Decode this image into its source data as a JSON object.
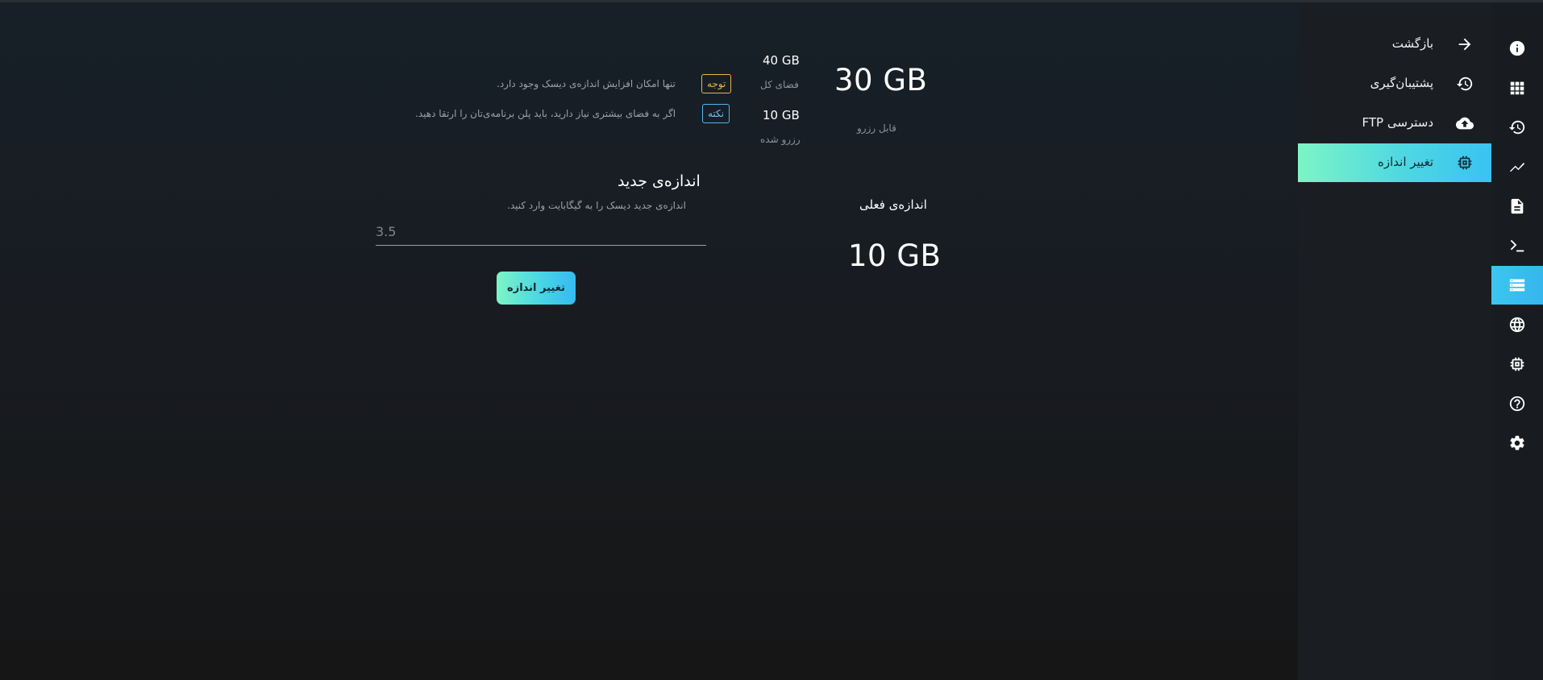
{
  "sidebar": {
    "items": [
      {
        "label": "بازگشت",
        "icon": "arrow-right-icon",
        "active": false
      },
      {
        "label": "پشتیبان‌گیری",
        "icon": "history-icon",
        "active": false
      },
      {
        "label": "دسترسی FTP",
        "icon": "cloud-upload-icon",
        "active": false
      },
      {
        "label": "تغییر اندازه",
        "icon": "chip-icon",
        "active": true
      }
    ]
  },
  "rail": {
    "items": [
      {
        "icon": "info-icon",
        "active": false
      },
      {
        "icon": "grid-icon",
        "active": false
      },
      {
        "icon": "history-icon",
        "active": false
      },
      {
        "icon": "chart-line-icon",
        "active": false
      },
      {
        "icon": "document-icon",
        "active": false
      },
      {
        "icon": "terminal-icon",
        "active": false
      },
      {
        "icon": "storage-icon",
        "active": true
      },
      {
        "icon": "globe-icon",
        "active": false
      },
      {
        "icon": "chip-icon",
        "active": false
      },
      {
        "icon": "help-icon",
        "active": false
      },
      {
        "icon": "gear-icon",
        "active": false
      }
    ]
  },
  "stats": {
    "available_value": "30 GB",
    "available_label": "قابل رزرو",
    "total_value": "40 GB",
    "total_label": "فضای کل",
    "reserved_value": "10 GB",
    "reserved_label": "رزرو شده",
    "current_label": "اندازه‌ی فعلی",
    "current_value": "10 GB"
  },
  "notices": {
    "warning_badge": "توجه",
    "warning_text": "تنها امکان افزایش اندازه‌ی دیسک وجود دارد.",
    "info_badge": "نکته",
    "info_text": "اگر به فضای بیشتری نیاز دارید، باید پلن برنامه‌ی‌تان را ارتقا دهید."
  },
  "resize_form": {
    "title": "اندازه‌ی جدید",
    "description": "اندازه‌ی جدید دیسک را به گیگابایت وارد کنید.",
    "input_placeholder": "3.5",
    "input_value": "",
    "submit_label": "تغییر اندازه"
  },
  "colors": {
    "accent_gradient_start": "#7cf5c6",
    "accent_gradient_end": "#3ac2f2",
    "rail_active": "#3cc6f0",
    "warning": "#e7b64b",
    "info": "#4fb7f0"
  }
}
